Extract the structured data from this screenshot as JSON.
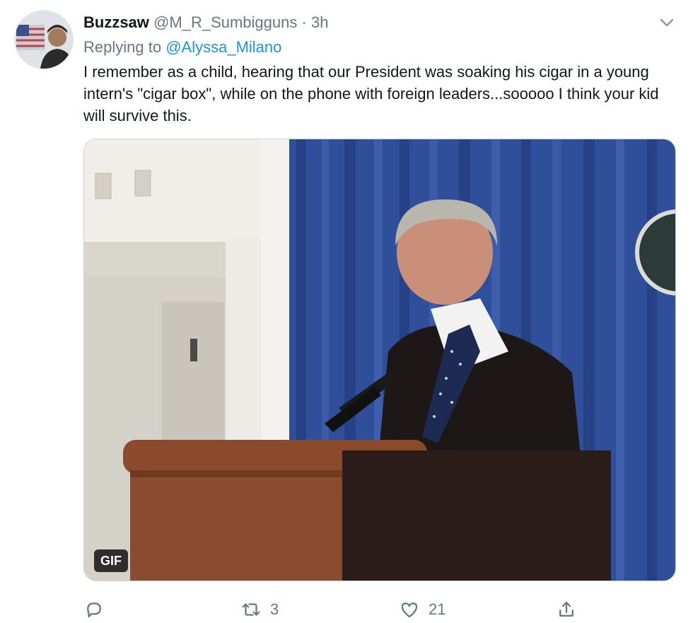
{
  "tweet": {
    "display_name": "Buzzsaw",
    "handle": "@M_R_Sumbigguns",
    "separator": "·",
    "time": "3h",
    "replying_prefix": "Replying to",
    "replying_to": "@Alyssa_Milano",
    "text": "I remember as a child, hearing that our President was soaking his cigar in a young intern's \"cigar box\", while on the phone with foreign leaders...sooooo I think your kid will survive this.",
    "media_badge": "GIF",
    "actions": {
      "reply": {
        "icon": "reply-icon",
        "count": ""
      },
      "retweet": {
        "icon": "retweet-icon",
        "count": "3"
      },
      "like": {
        "icon": "heart-icon",
        "count": "21"
      },
      "share": {
        "icon": "share-icon",
        "count": ""
      }
    },
    "colors": {
      "link": "#1b95e0",
      "secondary_text": "#657786",
      "curtain": "#2f4f9a",
      "podium": "#8b4a2b"
    }
  }
}
